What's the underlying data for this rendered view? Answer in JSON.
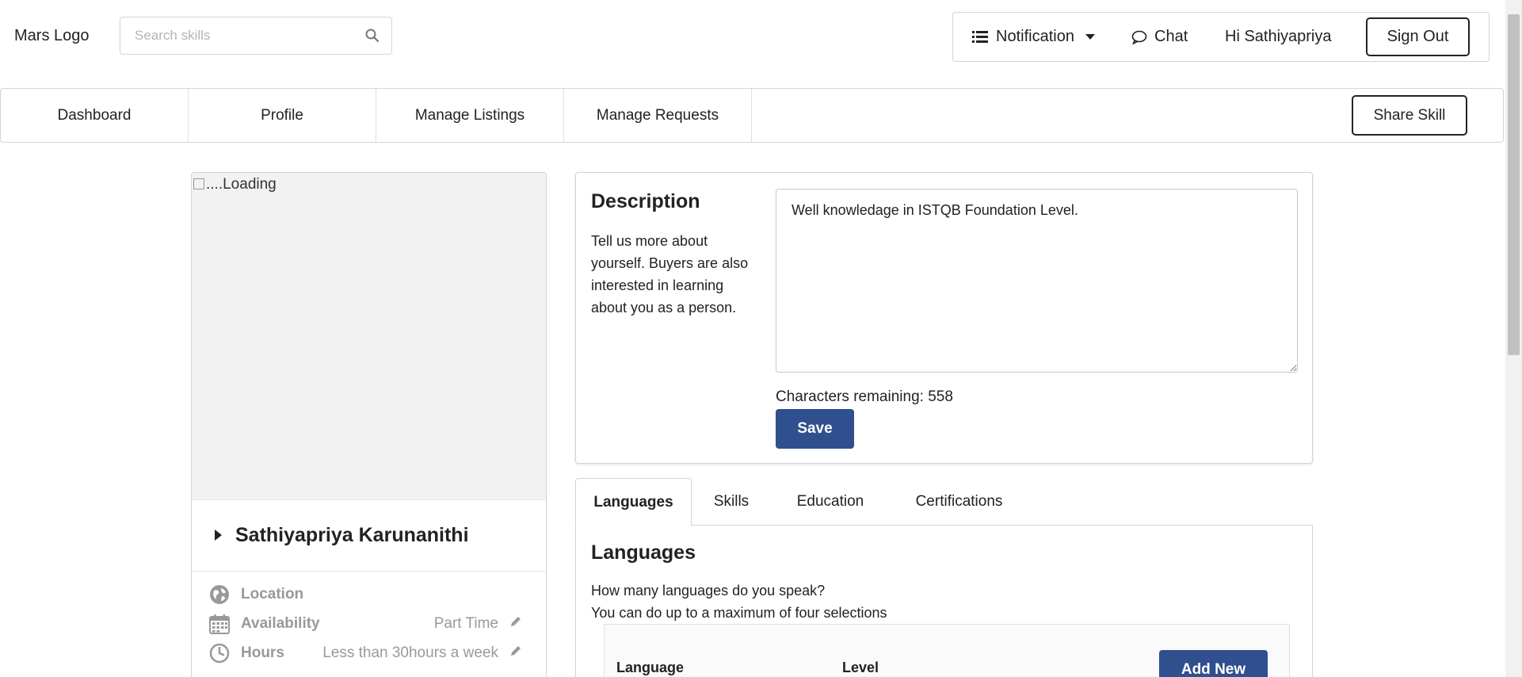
{
  "header": {
    "logo": "Mars Logo",
    "search_placeholder": "Search skills",
    "notification_label": "Notification",
    "chat_label": "Chat",
    "greeting": "Hi Sathiyapriya",
    "signout_label": "Sign Out"
  },
  "nav": {
    "items": [
      "Dashboard",
      "Profile",
      "Manage Listings",
      "Manage Requests"
    ],
    "share_label": "Share Skill"
  },
  "profile": {
    "image_alt": "....Loading",
    "name": "Sathiyapriya Karunanithi",
    "details": [
      {
        "label": "Location",
        "value": "",
        "icon": "globe-icon"
      },
      {
        "label": "Availability",
        "value": "Part Time",
        "icon": "calendar-icon"
      },
      {
        "label": "Hours",
        "value": "Less than 30hours a week",
        "icon": "clock-icon"
      }
    ]
  },
  "description": {
    "title": "Description",
    "hint": "Tell us more about yourself. Buyers are also interested in learning about you as a person.",
    "text": "Well knowledage in ISTQB Foundation Level.",
    "remaining": "Characters remaining: 558",
    "save_label": "Save"
  },
  "tabs": {
    "items": [
      "Languages",
      "Skills",
      "Education",
      "Certifications"
    ],
    "active": "Languages"
  },
  "languages": {
    "title": "Languages",
    "line1": "How many languages do you speak?",
    "line2": "You can do up to a maximum of four selections",
    "col_language": "Language",
    "col_level": "Level",
    "add_label": "Add New"
  },
  "colors": {
    "primary_button": "#2f4f8f",
    "border": "#d4d4d5"
  }
}
